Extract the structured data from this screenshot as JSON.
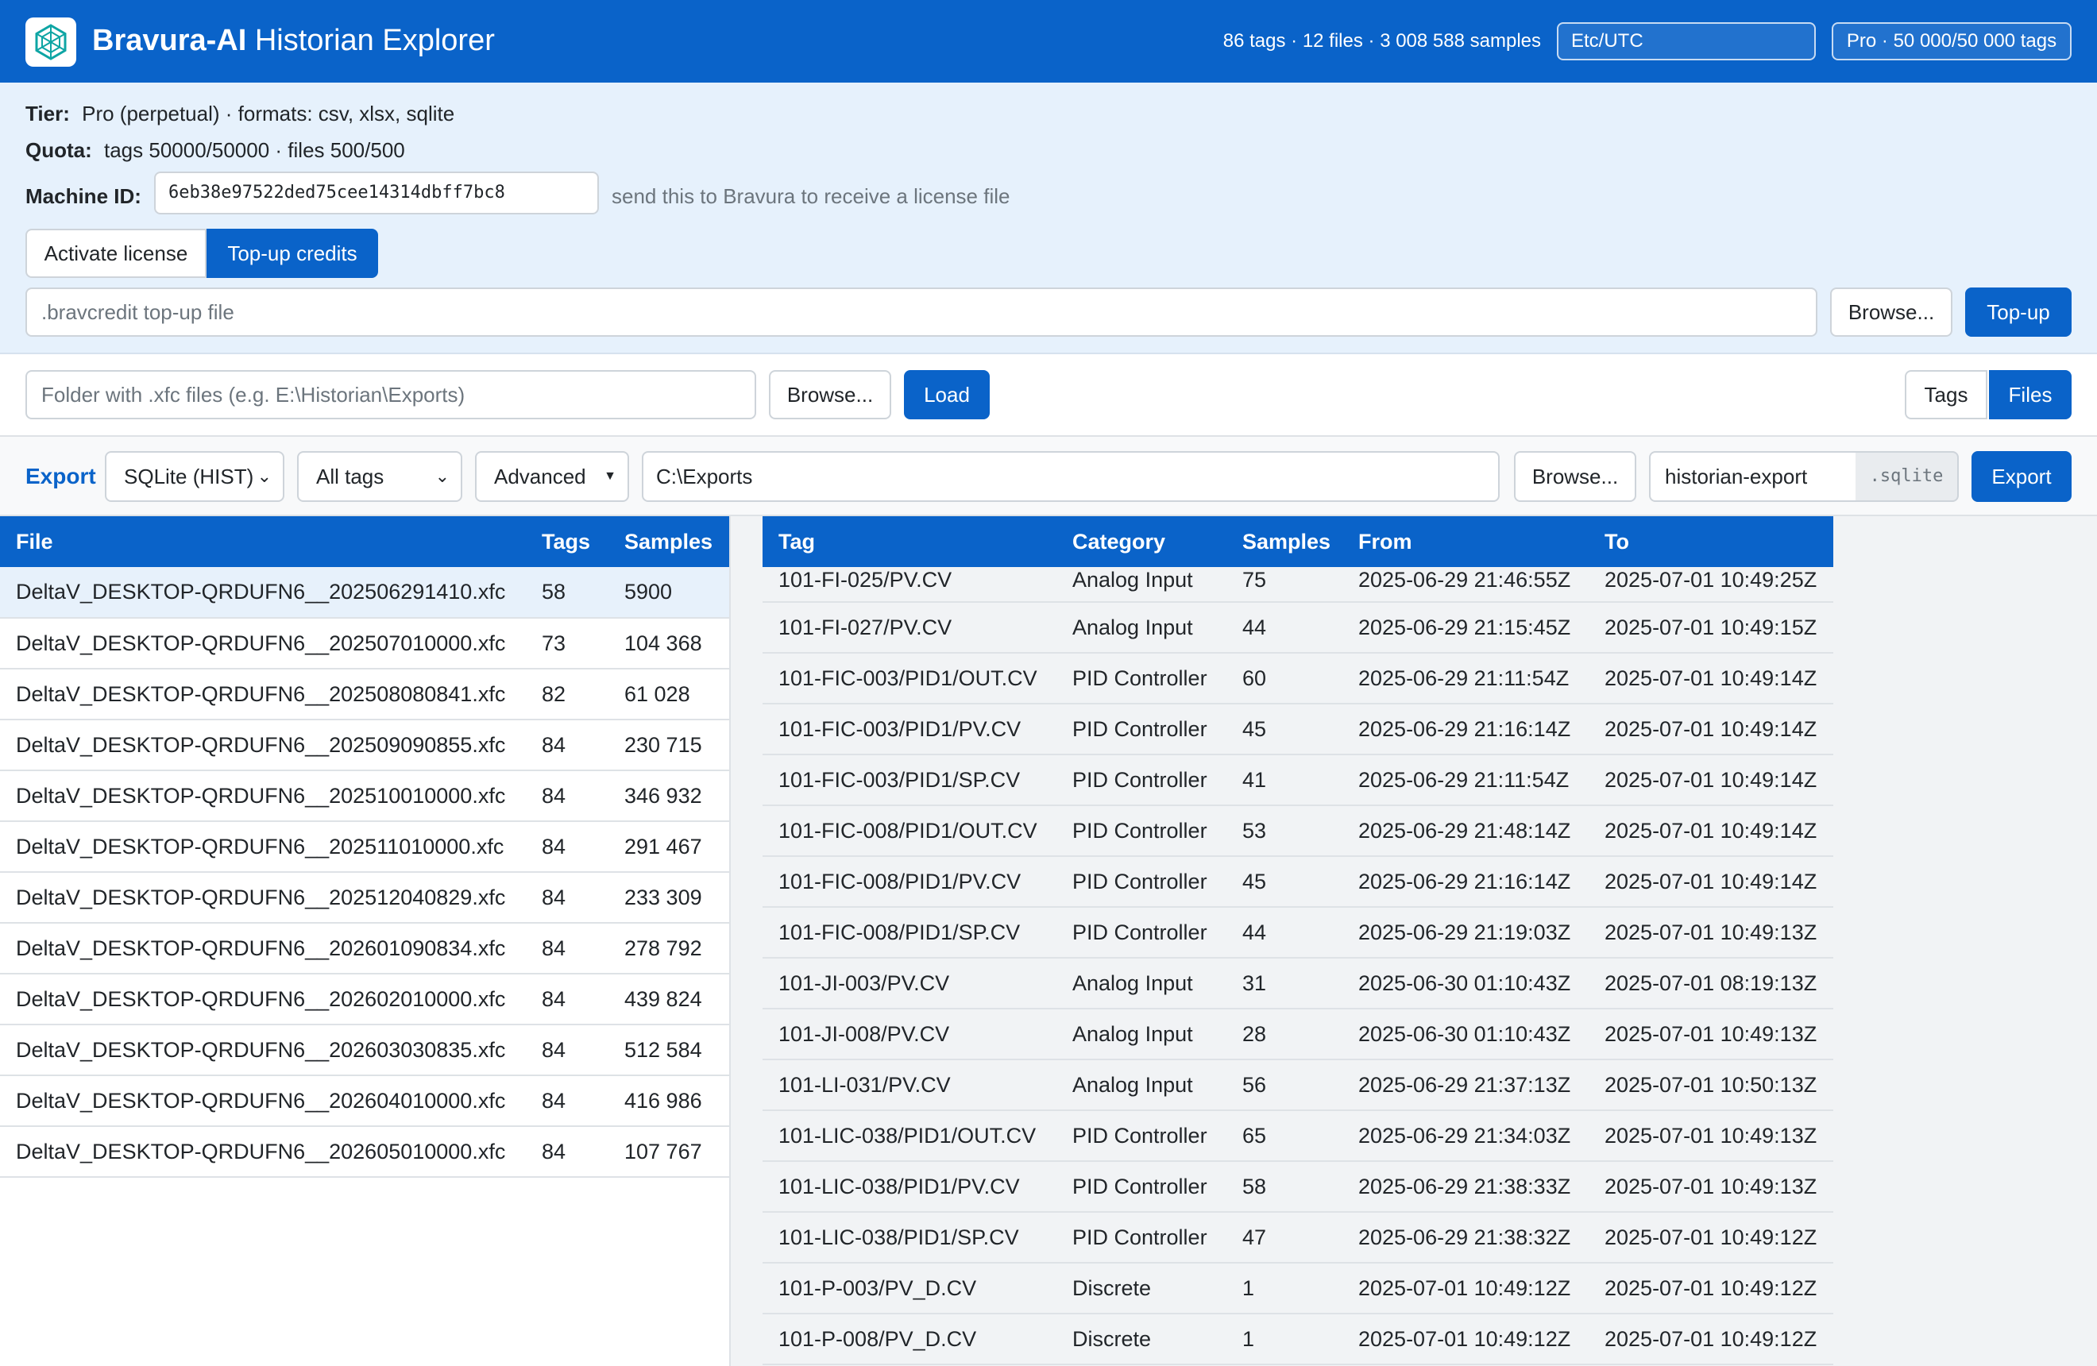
{
  "header": {
    "brand_bold": "Bravura-AI",
    "brand_rest": "Historian Explorer",
    "stats": "86 tags · 12 files · 3 008 588 samples",
    "timezone": "Etc/UTC",
    "plan": "Pro · 50 000/50 000 tags"
  },
  "license": {
    "tier_label": "Tier:",
    "tier_value": "Pro (perpetual) · formats: csv, xlsx, sqlite",
    "quota_label": "Quota:",
    "quota_value": "tags 50000/50000 · files 500/500",
    "machine_label": "Machine ID:",
    "machine_id": "6eb38e97522ded75cee14314dbff7bc8",
    "machine_hint": "send this to Bravura to receive a license file",
    "tab_activate": "Activate license",
    "tab_topup": "Top-up credits",
    "topup_placeholder": ".bravcredit top-up file",
    "browse_label": "Browse...",
    "topup_button": "Top-up"
  },
  "load": {
    "folder_placeholder": "Folder with .xfc files (e.g. E:\\Historian\\Exports)",
    "browse_label": "Browse...",
    "load_button": "Load",
    "view_tags": "Tags",
    "view_files": "Files"
  },
  "export": {
    "label": "Export",
    "format": "SQLite (HIST)",
    "scope": "All tags",
    "advanced": "Advanced",
    "path": "C:\\Exports",
    "browse_label": "Browse...",
    "filename": "historian-export",
    "extension": ".sqlite",
    "export_button": "Export"
  },
  "files": {
    "columns": [
      "File",
      "Tags",
      "Samples"
    ],
    "rows": [
      [
        "DeltaV_DESKTOP-QRDUFN6__202506291410.xfc",
        "58",
        "5900"
      ],
      [
        "DeltaV_DESKTOP-QRDUFN6__202507010000.xfc",
        "73",
        "104 368"
      ],
      [
        "DeltaV_DESKTOP-QRDUFN6__202508080841.xfc",
        "82",
        "61 028"
      ],
      [
        "DeltaV_DESKTOP-QRDUFN6__202509090855.xfc",
        "84",
        "230 715"
      ],
      [
        "DeltaV_DESKTOP-QRDUFN6__202510010000.xfc",
        "84",
        "346 932"
      ],
      [
        "DeltaV_DESKTOP-QRDUFN6__202511010000.xfc",
        "84",
        "291 467"
      ],
      [
        "DeltaV_DESKTOP-QRDUFN6__202512040829.xfc",
        "84",
        "233 309"
      ],
      [
        "DeltaV_DESKTOP-QRDUFN6__202601090834.xfc",
        "84",
        "278 792"
      ],
      [
        "DeltaV_DESKTOP-QRDUFN6__202602010000.xfc",
        "84",
        "439 824"
      ],
      [
        "DeltaV_DESKTOP-QRDUFN6__202603030835.xfc",
        "84",
        "512 584"
      ],
      [
        "DeltaV_DESKTOP-QRDUFN6__202604010000.xfc",
        "84",
        "416 986"
      ],
      [
        "DeltaV_DESKTOP-QRDUFN6__202605010000.xfc",
        "84",
        "107 767"
      ]
    ]
  },
  "tags": {
    "columns": [
      "Tag",
      "Category",
      "Samples",
      "From",
      "To"
    ],
    "rows": [
      [
        "101-FI-025/PV.CV",
        "Analog Input",
        "75",
        "2025-06-29 21:46:55Z",
        "2025-07-01 10:49:25Z"
      ],
      [
        "101-FI-027/PV.CV",
        "Analog Input",
        "44",
        "2025-06-29 21:15:45Z",
        "2025-07-01 10:49:15Z"
      ],
      [
        "101-FIC-003/PID1/OUT.CV",
        "PID Controller",
        "60",
        "2025-06-29 21:11:54Z",
        "2025-07-01 10:49:14Z"
      ],
      [
        "101-FIC-003/PID1/PV.CV",
        "PID Controller",
        "45",
        "2025-06-29 21:16:14Z",
        "2025-07-01 10:49:14Z"
      ],
      [
        "101-FIC-003/PID1/SP.CV",
        "PID Controller",
        "41",
        "2025-06-29 21:11:54Z",
        "2025-07-01 10:49:14Z"
      ],
      [
        "101-FIC-008/PID1/OUT.CV",
        "PID Controller",
        "53",
        "2025-06-29 21:48:14Z",
        "2025-07-01 10:49:14Z"
      ],
      [
        "101-FIC-008/PID1/PV.CV",
        "PID Controller",
        "45",
        "2025-06-29 21:16:14Z",
        "2025-07-01 10:49:14Z"
      ],
      [
        "101-FIC-008/PID1/SP.CV",
        "PID Controller",
        "44",
        "2025-06-29 21:19:03Z",
        "2025-07-01 10:49:13Z"
      ],
      [
        "101-JI-003/PV.CV",
        "Analog Input",
        "31",
        "2025-06-30 01:10:43Z",
        "2025-07-01 08:19:13Z"
      ],
      [
        "101-JI-008/PV.CV",
        "Analog Input",
        "28",
        "2025-06-30 01:10:43Z",
        "2025-07-01 10:49:13Z"
      ],
      [
        "101-LI-031/PV.CV",
        "Analog Input",
        "56",
        "2025-06-29 21:37:13Z",
        "2025-07-01 10:50:13Z"
      ],
      [
        "101-LIC-038/PID1/OUT.CV",
        "PID Controller",
        "65",
        "2025-06-29 21:34:03Z",
        "2025-07-01 10:49:13Z"
      ],
      [
        "101-LIC-038/PID1/PV.CV",
        "PID Controller",
        "58",
        "2025-06-29 21:38:33Z",
        "2025-07-01 10:49:13Z"
      ],
      [
        "101-LIC-038/PID1/SP.CV",
        "PID Controller",
        "47",
        "2025-06-29 21:38:32Z",
        "2025-07-01 10:49:12Z"
      ],
      [
        "101-P-003/PV_D.CV",
        "Discrete",
        "1",
        "2025-07-01 10:49:12Z",
        "2025-07-01 10:49:12Z"
      ],
      [
        "101-P-008/PV_D.CV",
        "Discrete",
        "1",
        "2025-07-01 10:49:12Z",
        "2025-07-01 10:49:12Z"
      ]
    ]
  }
}
